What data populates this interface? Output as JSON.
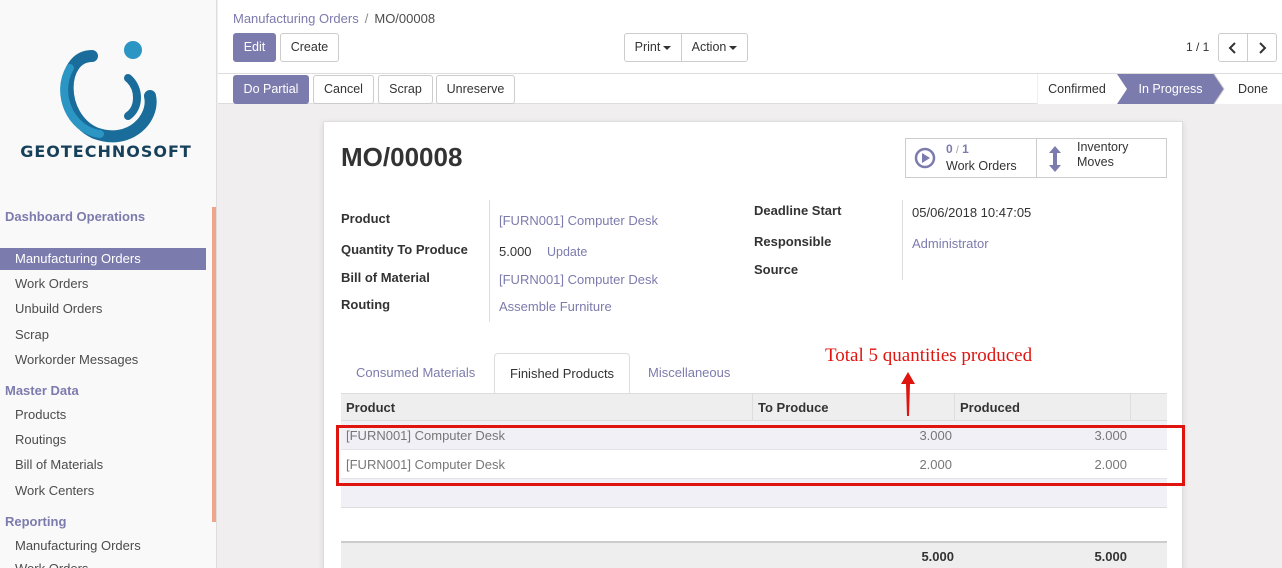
{
  "sidebar": {
    "logo_text": "GEOTECHNOSOFT",
    "sections": [
      {
        "label": "Dashboard Operations"
      },
      {
        "label": "Master Data"
      },
      {
        "label": "Reporting"
      }
    ],
    "items": [
      {
        "label": "Manufacturing Orders"
      },
      {
        "label": "Work Orders"
      },
      {
        "label": "Unbuild Orders"
      },
      {
        "label": "Scrap"
      },
      {
        "label": "Workorder Messages"
      },
      {
        "label": "Products"
      },
      {
        "label": "Routings"
      },
      {
        "label": "Bill of Materials"
      },
      {
        "label": "Work Centers"
      },
      {
        "label": "Manufacturing Orders"
      },
      {
        "label": "Work Orders"
      }
    ]
  },
  "breadcrumb": {
    "parent": "Manufacturing Orders",
    "separator": "/",
    "current": "MO/00008"
  },
  "toolbar": {
    "edit": "Edit",
    "create": "Create",
    "print": "Print",
    "action": "Action",
    "pager": "1 / 1"
  },
  "actions": {
    "do_partial": "Do Partial",
    "cancel": "Cancel",
    "scrap": "Scrap",
    "unreserve": "Unreserve"
  },
  "stages": [
    "Confirmed",
    "In Progress",
    "Done"
  ],
  "active_stage": "In Progress",
  "record": {
    "name": "MO/00008",
    "smart_buttons": {
      "work_orders_count": "0",
      "work_orders_slash": "/",
      "work_orders_total": "1",
      "work_orders_label": "Work Orders",
      "inventory_label_1": "Inventory",
      "inventory_label_2": "Moves"
    },
    "fields": {
      "product_label": "Product",
      "product": "[FURN001] Computer Desk",
      "qty_label": "Quantity To Produce",
      "qty": "5.000",
      "update": "Update",
      "bom_label": "Bill of Material",
      "bom": "[FURN001] Computer Desk",
      "routing_label": "Routing",
      "routing": "Assemble Furniture",
      "deadline_label": "Deadline Start",
      "deadline": "05/06/2018 10:47:05",
      "responsible_label": "Responsible",
      "responsible": "Administrator",
      "source_label": "Source"
    }
  },
  "tabs": [
    "Consumed Materials",
    "Finished Products",
    "Miscellaneous"
  ],
  "table": {
    "headers": [
      "Product",
      "To Produce",
      "Produced"
    ],
    "rows": [
      {
        "product": "[FURN001] Computer Desk",
        "to_produce": "3.000",
        "produced": "3.000"
      },
      {
        "product": "[FURN001] Computer Desk",
        "to_produce": "2.000",
        "produced": "2.000"
      }
    ],
    "totals": {
      "to_produce": "5.000",
      "produced": "5.000"
    }
  },
  "annotation": {
    "text": "Total 5 quantities produced",
    "color": "#e0140f"
  },
  "colors": {
    "accent": "#7c7bad",
    "annotation": "#e0140f"
  }
}
